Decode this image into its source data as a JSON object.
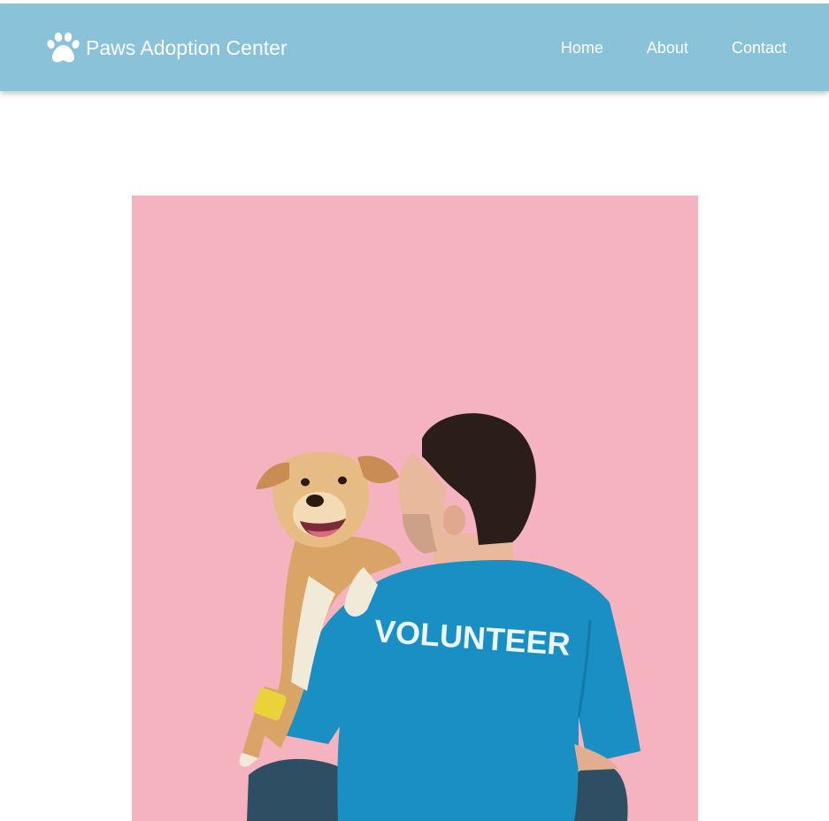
{
  "header": {
    "brand_name": "Paws Adoption Center",
    "brand_icon": "paw-icon",
    "background_color": "#89c2d9"
  },
  "nav": {
    "items": [
      {
        "label": "Home"
      },
      {
        "label": "About"
      },
      {
        "label": "Contact"
      }
    ]
  },
  "hero": {
    "shirt_text": "VOLUNTEER",
    "background_color": "#f5b3bf",
    "shirt_color": "#1a8fc4"
  }
}
